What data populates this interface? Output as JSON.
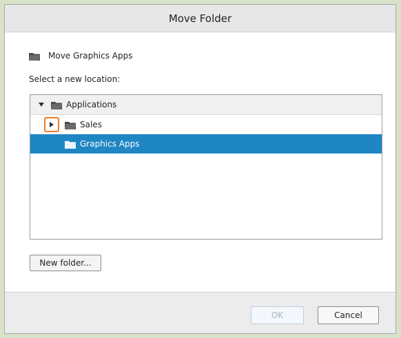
{
  "dialog": {
    "title": "Move Folder",
    "subject_label": "Move Graphics Apps",
    "prompt": "Select a new location:",
    "tree": {
      "root": {
        "label": "Applications",
        "expanded": true
      },
      "children": [
        {
          "label": "Sales",
          "expanded": false,
          "highlighted_expander": true
        },
        {
          "label": "Graphics Apps",
          "selected": true
        }
      ]
    },
    "new_folder_label": "New folder...",
    "ok_label": "OK",
    "ok_enabled": false,
    "cancel_label": "Cancel"
  },
  "colors": {
    "selection": "#1f86c4",
    "highlight_outline": "#f07a22",
    "background": "#d7e2c8"
  }
}
